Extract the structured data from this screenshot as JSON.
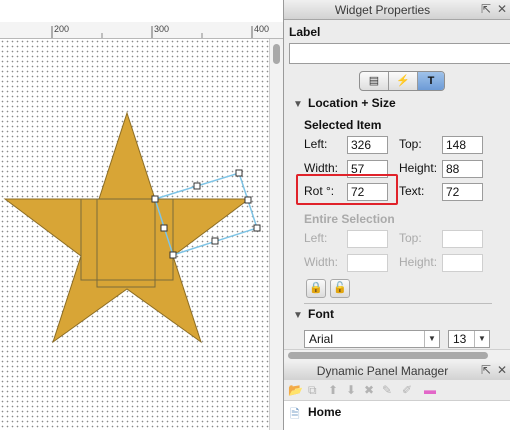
{
  "ruler": {
    "labels": [
      "200",
      "300",
      "400"
    ]
  },
  "widget_properties": {
    "title": "Widget Properties",
    "label_heading": "Label",
    "label_value": "",
    "tabs": [
      {
        "icon": "properties-icon",
        "selected": false
      },
      {
        "icon": "interactions-icon",
        "selected": false
      },
      {
        "icon": "format-icon",
        "selected": true
      }
    ],
    "location_size": {
      "heading": "Location + Size",
      "selected_item_heading": "Selected Item",
      "left_label": "Left:",
      "left_value": "326",
      "top_label": "Top:",
      "top_value": "148",
      "width_label": "Width:",
      "width_value": "57",
      "height_label": "Height:",
      "height_value": "88",
      "rot_label": "Rot °:",
      "rot_value": "72",
      "text_label": "Text:",
      "text_value": "72",
      "entire_selection_heading": "Entire Selection",
      "es_left_label": "Left:",
      "es_top_label": "Top:",
      "es_width_label": "Width:",
      "es_height_label": "Height:"
    },
    "font": {
      "heading": "Font",
      "family": "Arial",
      "size": "13"
    }
  },
  "dynamic_panel_manager": {
    "title": "Dynamic Panel Manager",
    "items": [
      {
        "label": "Home"
      }
    ]
  },
  "colors": {
    "star_fill": "#d8a536",
    "selection_box": "#7ec4e6",
    "highlight": "#e0222a"
  }
}
